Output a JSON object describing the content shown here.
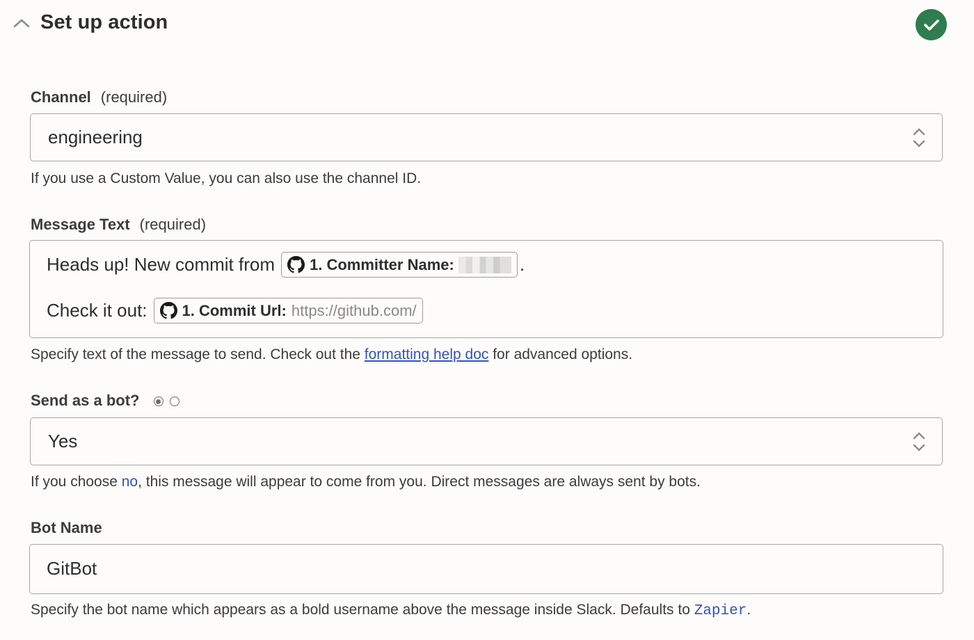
{
  "header": {
    "title": "Set up action",
    "collapse_icon": "chevron-up-icon",
    "status_icon": "check-circle-icon",
    "status_color": "#2e7d4f"
  },
  "channel": {
    "label": "Channel",
    "required": "(required)",
    "value": "engineering",
    "help": "If you use a Custom Value, you can also use the channel ID."
  },
  "message_text": {
    "label": "Message Text",
    "required": "(required)",
    "line1_text": "Heads up! New commit from",
    "line1_pill": {
      "icon": "github-icon",
      "label": "1. Committer Name:",
      "value_redacted": true
    },
    "line1_trailing": ".",
    "line2_text": "Check it out:",
    "line2_pill": {
      "icon": "github-icon",
      "label": "1. Commit Url:",
      "value": "https://github.com/"
    },
    "help_before": "Specify text of the message to send. Check out the ",
    "help_link": "formatting help doc",
    "help_after": " for advanced options."
  },
  "send_as_bot": {
    "label": "Send as a bot?",
    "radio_options": [
      "selected",
      "unselected"
    ],
    "value": "Yes",
    "help_before": "If you choose ",
    "help_link": "no",
    "help_after": ", this message will appear to come from you. Direct messages are always sent by bots."
  },
  "bot_name": {
    "label": "Bot Name",
    "value": "GitBot",
    "help_before": "Specify the bot name which appears as a bold username above the message inside Slack. Defaults to ",
    "help_code": "Zapier",
    "help_after": "."
  },
  "colors": {
    "link": "#3452c2",
    "background": "#fdfcfa",
    "border": "#a8a7a3"
  }
}
